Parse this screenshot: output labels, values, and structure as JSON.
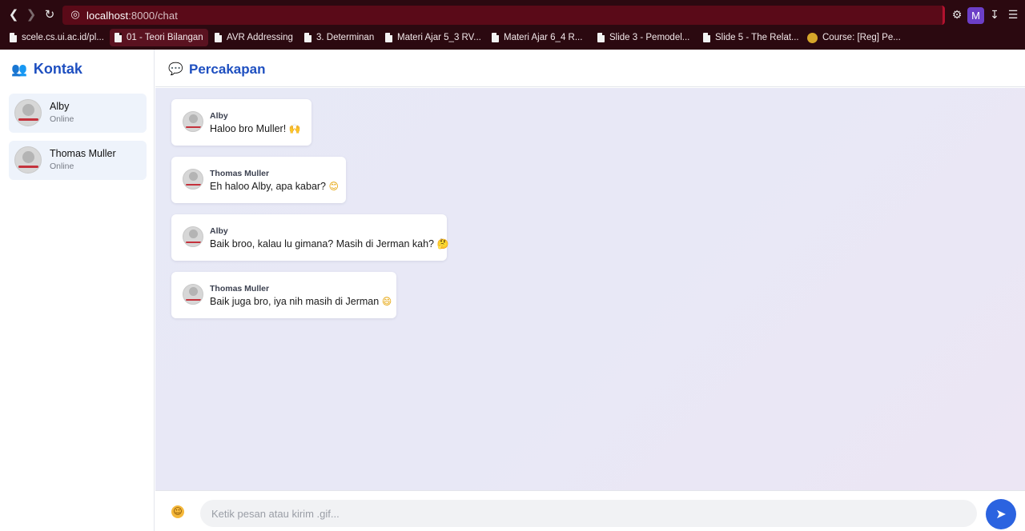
{
  "browser": {
    "url_host": "localhost",
    "url_path": ":8000/chat",
    "profile_initial": "M",
    "bookmarks": [
      {
        "label": "scele.cs.ui.ac.id/pl...",
        "icon": "document-icon"
      },
      {
        "label": "01 - Teori Bilangan",
        "icon": "document-icon"
      },
      {
        "label": "AVR Addressing",
        "icon": "document-icon"
      },
      {
        "label": "3. Determinan",
        "icon": "document-icon"
      },
      {
        "label": "Materi Ajar 5_3 RV...",
        "icon": "document-icon"
      },
      {
        "label": "Materi Ajar 6_4 R...",
        "icon": "document-icon"
      },
      {
        "label": "Slide 3 - Pemodel...",
        "icon": "document-icon"
      },
      {
        "label": "Slide 5 - The Relat...",
        "icon": "document-icon"
      },
      {
        "label": "Course: [Reg] Pe...",
        "icon": "course-icon"
      }
    ]
  },
  "sidebar": {
    "title": "Kontak",
    "contacts": [
      {
        "name": "Alby",
        "status": "Online"
      },
      {
        "name": "Thomas Muller",
        "status": "Online"
      }
    ]
  },
  "chat": {
    "title": "Percakapan",
    "messages": [
      {
        "sender": "Alby",
        "text": "Haloo bro Muller!",
        "emoji": "🙌"
      },
      {
        "sender": "Thomas Muller",
        "text": "Eh haloo Alby, apa kabar?",
        "emoji": "😊"
      },
      {
        "sender": "Alby",
        "text": "Baik broo, kalau lu gimana? Masih di Jerman kah?",
        "emoji": "🤔"
      },
      {
        "sender": "Thomas Muller",
        "text": "Baik juga bro, iya nih masih di Jerman",
        "emoji": "😄"
      }
    ],
    "input_placeholder": "Ketik pesan atau kirim .gif..."
  },
  "colors": {
    "accent": "#1e4fc0",
    "send_button": "#2b63e0",
    "browser_frame": "#2b0910"
  }
}
